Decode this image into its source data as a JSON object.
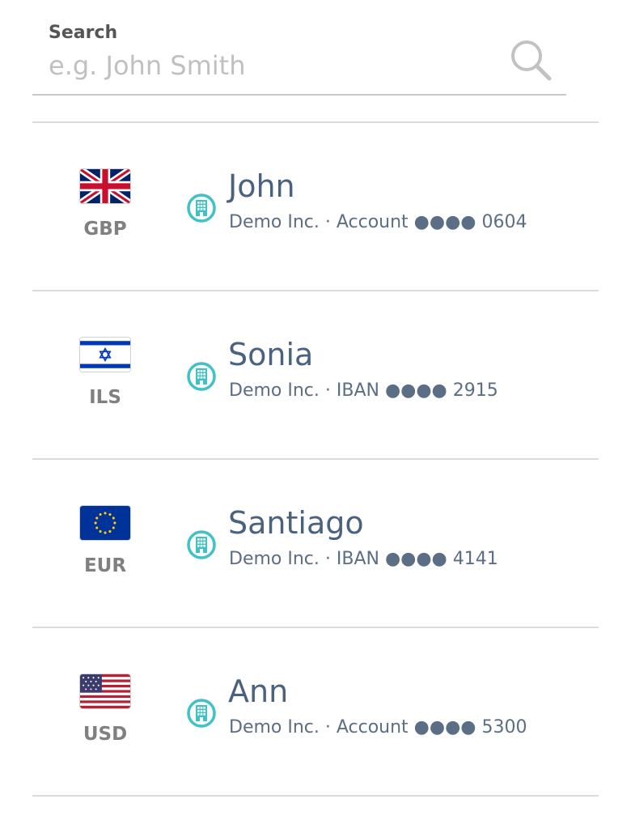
{
  "search": {
    "label": "Search",
    "placeholder": "e.g. John Smith",
    "value": "",
    "icon": "search-icon"
  },
  "recipients": [
    {
      "name": "John",
      "currency": "GBP",
      "flag": "uk-flag-icon",
      "details": "Demo Inc. · Account ●●●● 0604",
      "type_icon": "bank-building-icon"
    },
    {
      "name": "Sonia",
      "currency": "ILS",
      "flag": "israel-flag-icon",
      "details": "Demo Inc. · IBAN ●●●● 2915",
      "type_icon": "bank-building-icon"
    },
    {
      "name": "Santiago",
      "currency": "EUR",
      "flag": "eu-flag-icon",
      "details": "Demo Inc. · IBAN ●●●● 4141",
      "type_icon": "bank-building-icon"
    },
    {
      "name": "Ann",
      "currency": "USD",
      "flag": "us-flag-icon",
      "details": "Demo Inc. · Account ●●●● 5300",
      "type_icon": "bank-building-icon"
    }
  ],
  "colors": {
    "name_text": "#4a6180",
    "detail_text": "#5a6e86",
    "currency_text": "#808080",
    "accent": "#3fc1c9",
    "placeholder": "#c0c0c0",
    "divider": "#dcdcdc"
  }
}
